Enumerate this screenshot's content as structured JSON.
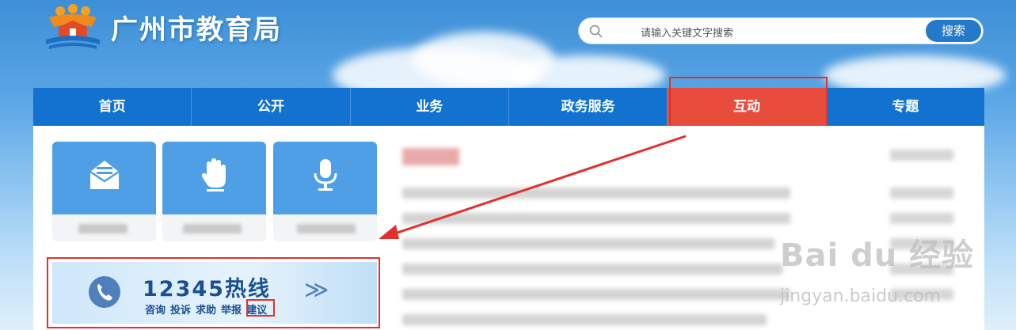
{
  "header": {
    "site_title": "广州市教育局",
    "logo_icon": "education-bureau-logo-icon",
    "search": {
      "placeholder": "请输入关键文字搜索",
      "button_label": "搜索",
      "icon": "search-icon"
    }
  },
  "nav": {
    "items": [
      {
        "label": "首页"
      },
      {
        "label": "公开"
      },
      {
        "label": "业务"
      },
      {
        "label": "政务服务"
      },
      {
        "label": "互动",
        "active": true
      },
      {
        "label": "专题"
      }
    ]
  },
  "tiles": [
    {
      "icon": "envelope-icon"
    },
    {
      "icon": "hand-icon"
    },
    {
      "icon": "microphone-icon"
    }
  ],
  "hotline": {
    "title": "12345热线",
    "actions": [
      "咨询",
      "投诉",
      "求助",
      "举报",
      "建议"
    ],
    "arrows": "≫",
    "icon": "phone-icon"
  },
  "watermark": {
    "brand": "Bai du 经验",
    "url": "jingyan.baidu.com"
  },
  "colors": {
    "nav_bg": "#1372cf",
    "nav_active": "#e84c3d",
    "highlight": "#e3302a",
    "tile_bg": "#4f9fe6"
  }
}
